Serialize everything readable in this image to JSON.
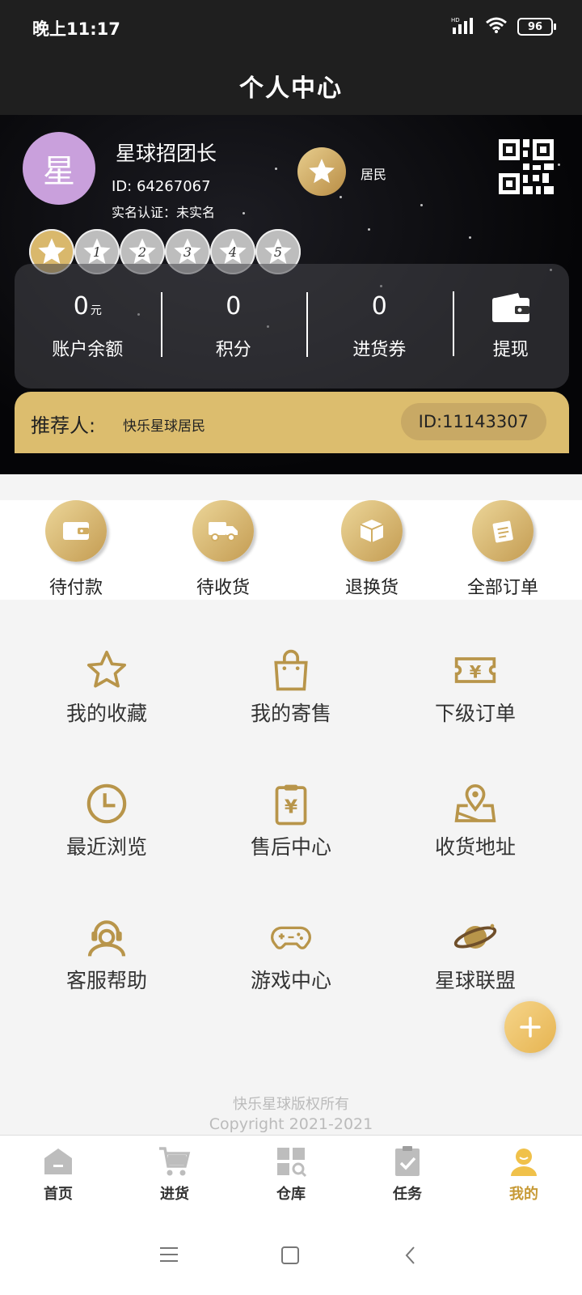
{
  "status_bar": {
    "time": "晚上11:17",
    "network": "HD",
    "battery": "96"
  },
  "header": {
    "title": "个人中心"
  },
  "profile": {
    "avatar_char": "星",
    "name": "星球招团长",
    "id_text": "ID: 64267067",
    "verify_text": "实名认证：未实名",
    "role": "居民",
    "levels": [
      "1",
      "2",
      "3",
      "4",
      "5"
    ]
  },
  "stats": [
    {
      "value": "0",
      "unit": "元",
      "label": "账户余额"
    },
    {
      "value": "0",
      "unit": "",
      "label": "积分"
    },
    {
      "value": "0",
      "unit": "",
      "label": "进货券"
    }
  ],
  "withdraw_label": "提现",
  "referrer": {
    "label": "推荐人:",
    "name": "快乐星球居民",
    "id": "ID:11143307"
  },
  "orders": [
    {
      "label": "待付款",
      "icon": "wallet-icon"
    },
    {
      "label": "待收货",
      "icon": "truck-icon"
    },
    {
      "label": "退换货",
      "icon": "box-icon"
    },
    {
      "label": "全部订单",
      "icon": "orders-icon"
    }
  ],
  "menu": [
    {
      "label": "我的收藏",
      "icon": "star-icon"
    },
    {
      "label": "我的寄售",
      "icon": "bag-icon"
    },
    {
      "label": "下级订单",
      "icon": "ticket-icon"
    },
    {
      "label": "最近浏览",
      "icon": "clock-icon"
    },
    {
      "label": "售后中心",
      "icon": "clipboard-yen-icon"
    },
    {
      "label": "收货地址",
      "icon": "map-pin-icon"
    },
    {
      "label": "客服帮助",
      "icon": "headset-icon"
    },
    {
      "label": "游戏中心",
      "icon": "gamepad-icon"
    },
    {
      "label": "星球联盟",
      "icon": "planet-icon"
    }
  ],
  "footer": {
    "copyright_cn": "快乐星球版权所有",
    "copyright_en": "Copyright 2021-2021"
  },
  "tabs": [
    {
      "label": "首页",
      "icon": "home-icon"
    },
    {
      "label": "进货",
      "icon": "cart-icon"
    },
    {
      "label": "仓库",
      "icon": "warehouse-icon"
    },
    {
      "label": "任务",
      "icon": "task-icon"
    },
    {
      "label": "我的",
      "icon": "user-icon",
      "active": true
    }
  ],
  "colors": {
    "gold": "#c79a36",
    "dark": "#1f1f1f"
  }
}
